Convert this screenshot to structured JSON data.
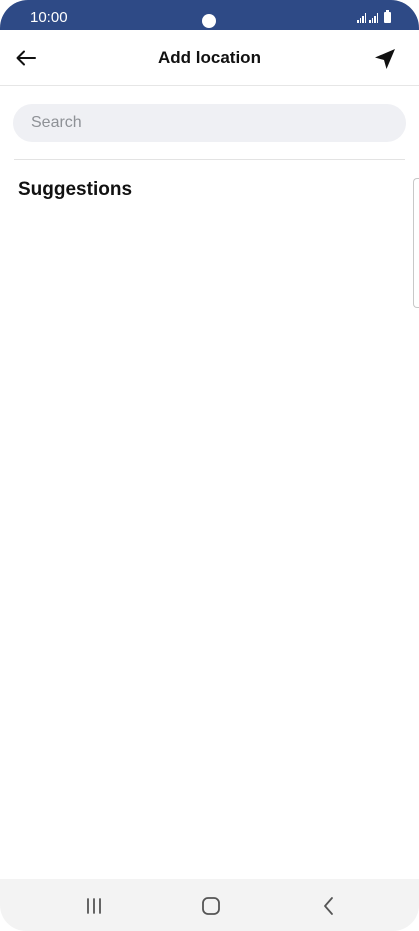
{
  "status_bar": {
    "time": "10:00"
  },
  "header": {
    "title": "Add location",
    "back_icon": "arrow-left-icon",
    "location_icon": "navigation-arrow-icon"
  },
  "search": {
    "placeholder": "Search",
    "value": ""
  },
  "suggestions": {
    "title": "Suggestions"
  },
  "nav_bar": {
    "recents_icon": "recents-icon",
    "home_icon": "home-icon",
    "back_icon": "chevron-left-icon"
  },
  "colors": {
    "status_bar": "#2e4a86",
    "search_bg": "#eff0f4",
    "nav_bar_bg": "#f3f3f3",
    "text": "#111111"
  }
}
